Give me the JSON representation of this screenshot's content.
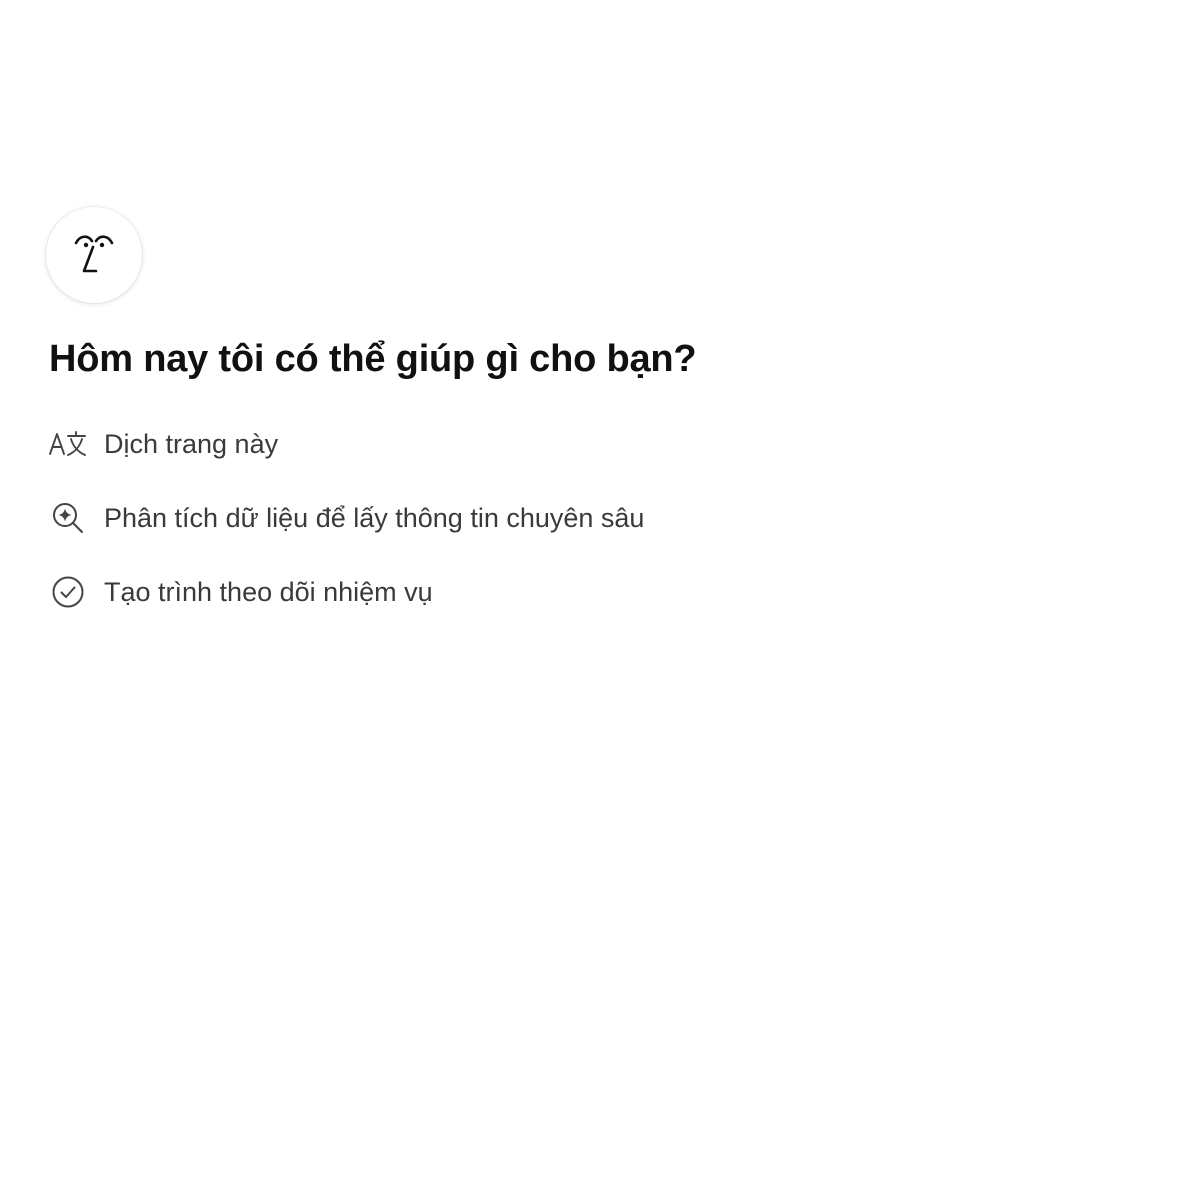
{
  "assistant": {
    "avatar_icon": "notion-ai-face-icon"
  },
  "greeting": "Hôm nay tôi có thể giúp gì cho bạn?",
  "suggestions": [
    {
      "icon": "translate-icon",
      "label": "Dịch trang này"
    },
    {
      "icon": "magnify-sparkle-icon",
      "label": "Phân tích dữ liệu để lấy thông tin chuyên sâu"
    },
    {
      "icon": "check-circle-icon",
      "label": "Tạo trình theo dõi nhiệm vụ"
    }
  ],
  "colors": {
    "background": "#ffffff",
    "heading": "#111111",
    "text": "#3a3a3a",
    "icon": "#444444"
  }
}
